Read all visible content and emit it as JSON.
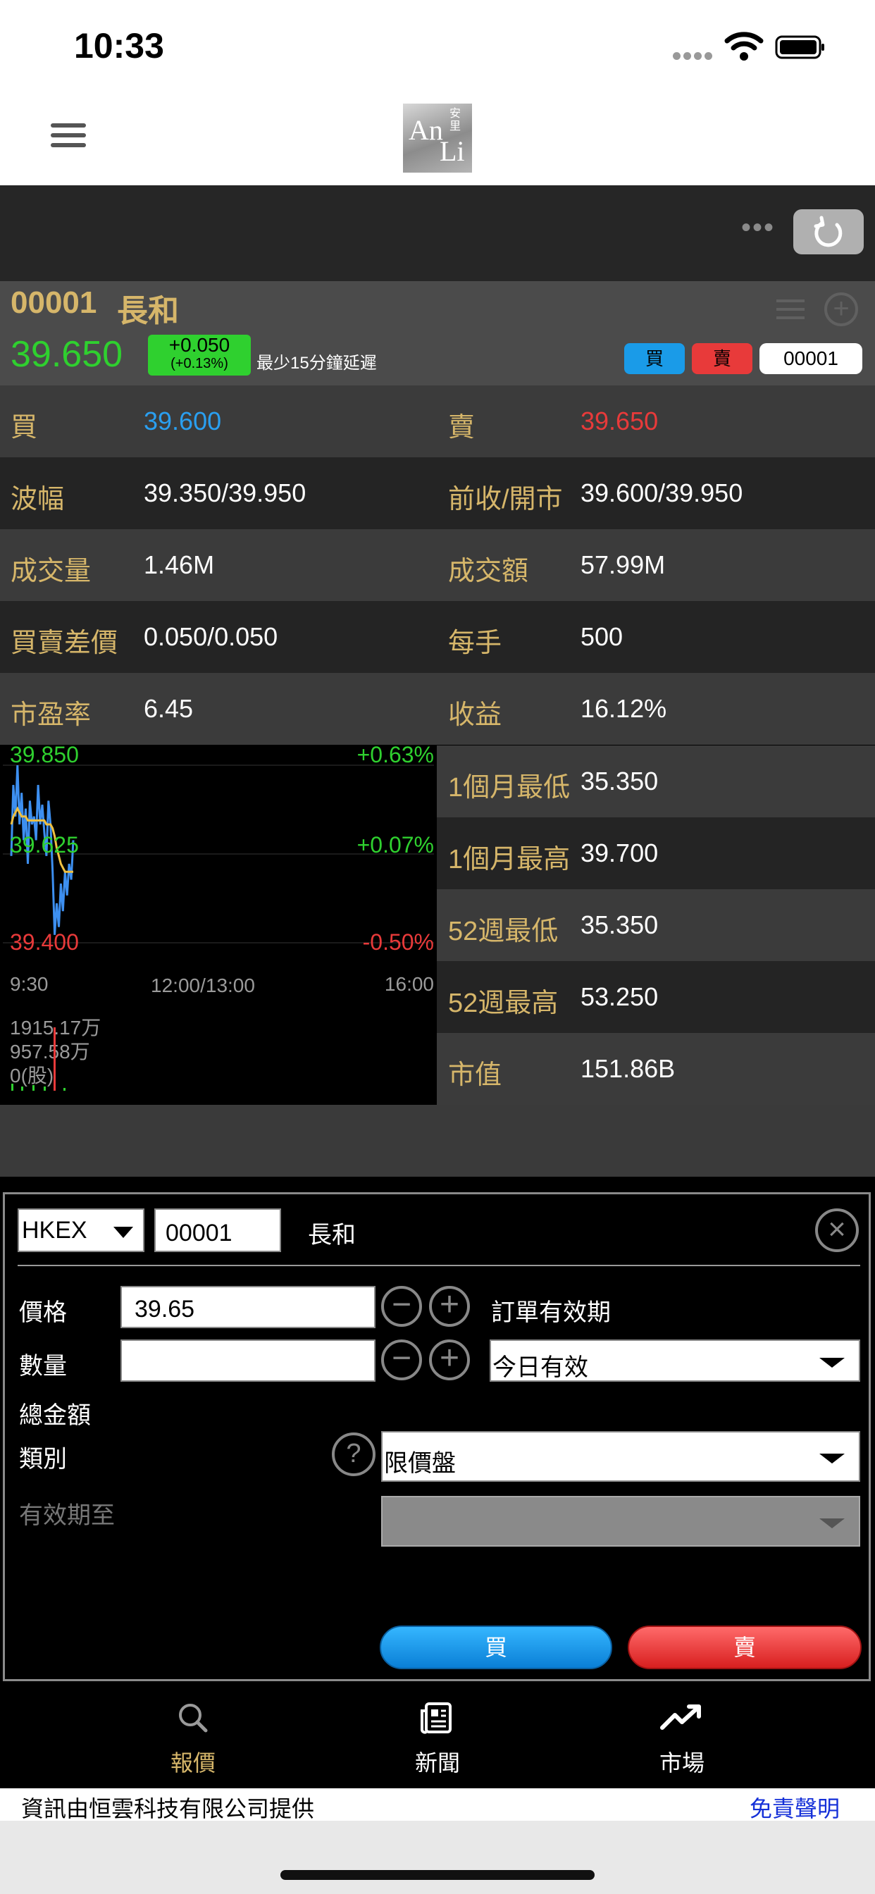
{
  "status": {
    "time": "10:33"
  },
  "header": {
    "logo_text": "AnLi",
    "logo_cn": "安里"
  },
  "stock": {
    "code": "00001",
    "name": "長和",
    "price": "39.650",
    "change": "+0.050",
    "change_pct": "(+0.13%)",
    "delay_note": "最少15分鐘延遲",
    "buy_label": "買",
    "sell_label": "賣",
    "code_field": "00001",
    "colors": {
      "up": "#2fd02f",
      "down": "#e83a3a",
      "label": "#d6b66a"
    }
  },
  "info_rows": [
    {
      "l1": "買",
      "v1": "39.600",
      "l2": "賣",
      "v2": "39.650"
    },
    {
      "l1": "波幅",
      "v1": "39.350/39.950",
      "l2": "前收/開市",
      "v2": "39.600/39.950"
    },
    {
      "l1": "成交量",
      "v1": "1.46M",
      "l2": "成交額",
      "v2": "57.99M"
    },
    {
      "l1": "買賣差價",
      "v1": "0.050/0.050",
      "l2": "每手",
      "v2": "500"
    },
    {
      "l1": "市盈率",
      "v1": "6.45",
      "l2": "收益",
      "v2": "16.12%"
    }
  ],
  "side_rows": [
    {
      "label": "1個月最低",
      "value": "35.350"
    },
    {
      "label": "1個月最高",
      "value": "39.700"
    },
    {
      "label": "52週最低",
      "value": "35.350"
    },
    {
      "label": "52週最高",
      "value": "53.250"
    },
    {
      "label": "市值",
      "value": "151.86B"
    }
  ],
  "chart_data": {
    "type": "line",
    "y_labels": [
      "39.850",
      "39.625",
      "39.400"
    ],
    "pct_labels": [
      "+0.63%",
      "+0.07%",
      "-0.50%"
    ],
    "x_labels": [
      "9:30",
      "12:00/13:00",
      "16:00"
    ],
    "ylim": [
      39.4,
      39.85
    ],
    "volume_labels": [
      "1915.17万",
      "957.58万",
      "0(股)"
    ],
    "series": [
      {
        "values": [
          39.62,
          39.8,
          39.72,
          39.85,
          39.7,
          39.78,
          39.66,
          39.74,
          39.6,
          39.76,
          39.7,
          39.72,
          39.66,
          39.8,
          39.7,
          39.75,
          39.68,
          39.62,
          39.76,
          39.7,
          39.58,
          39.42,
          39.5,
          39.44,
          39.55,
          39.48,
          39.58,
          39.52,
          39.6,
          39.56,
          39.66
        ],
        "color": "#3d8ff0"
      },
      {
        "values": [
          39.7,
          39.72,
          39.73,
          39.74,
          39.73,
          39.72,
          39.72,
          39.72,
          39.71,
          39.71,
          39.71,
          39.71,
          39.71,
          39.71,
          39.71,
          39.71,
          39.71,
          39.7,
          39.7,
          39.7,
          39.69,
          39.67,
          39.64,
          39.62,
          39.6,
          39.59,
          39.58,
          39.58,
          39.58,
          39.58,
          39.58
        ],
        "color": "#f0c040"
      }
    ]
  },
  "order": {
    "exchange": "HKEX",
    "code": "00001",
    "name": "長和",
    "price_label": "價格",
    "price_value": "39.65",
    "qty_label": "數量",
    "qty_value": "",
    "total_label": "總金額",
    "type_label": "類別",
    "type_value": "限價盤",
    "expiry_to_label": "有效期至",
    "validity_label": "訂單有效期",
    "validity_value": "今日有效",
    "buy_button": "買",
    "sell_button": "賣"
  },
  "nav": [
    {
      "label": "報價",
      "icon": "search-icon",
      "active": true
    },
    {
      "label": "新聞",
      "icon": "news-icon",
      "active": false
    },
    {
      "label": "市場",
      "icon": "trend-icon",
      "active": false
    }
  ],
  "footer": {
    "text": "資訊由恒雲科技有限公司提供",
    "disclaimer": "免責聲明"
  }
}
